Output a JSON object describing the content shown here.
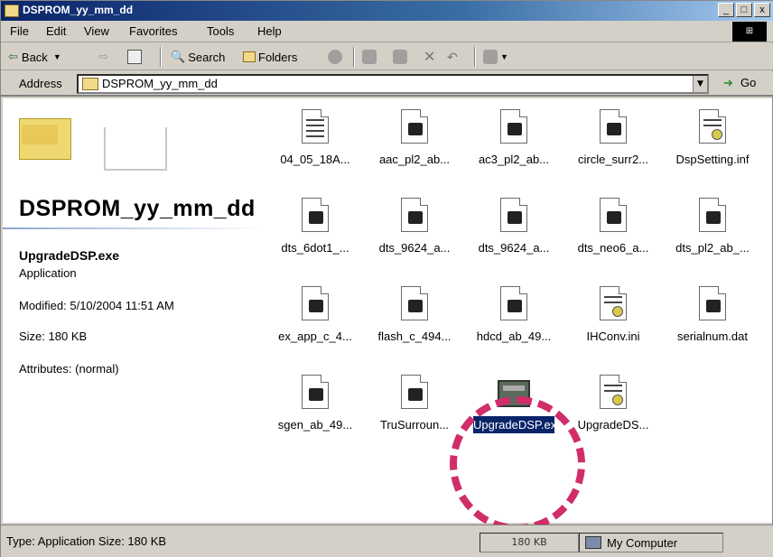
{
  "window": {
    "title": "DSPROM_yy_mm_dd",
    "buttons": [
      "_",
      "□",
      "x"
    ]
  },
  "menu": [
    "File",
    "Edit",
    "View",
    "Favorites",
    "Tools",
    "Help"
  ],
  "toolbar": {
    "back": "Back",
    "search": "Search",
    "folders": "Folders"
  },
  "address": {
    "label": "Address",
    "value": "DSPROM_yy_mm_dd",
    "go": "Go"
  },
  "left_panel": {
    "heading": "DSPROM_yy_mm_dd",
    "file_name": "UpgradeDSP.exe",
    "file_type": "Application",
    "modified": "Modified: 5/10/2004 11:51 AM",
    "size": "Size: 180 KB",
    "attributes": "Attributes: (normal)"
  },
  "files": [
    {
      "label": "04_05_18A...",
      "icon": "text-document-icon"
    },
    {
      "label": "aac_pl2_ab...",
      "icon": "binary-file-icon"
    },
    {
      "label": "ac3_pl2_ab...",
      "icon": "binary-file-icon"
    },
    {
      "label": "circle_surr2...",
      "icon": "binary-file-icon"
    },
    {
      "label": "DspSetting.inf",
      "icon": "settings-file-icon"
    },
    {
      "label": "dts_6dot1_...",
      "icon": "binary-file-icon"
    },
    {
      "label": "dts_9624_a...",
      "icon": "binary-file-icon"
    },
    {
      "label": "dts_9624_a...",
      "icon": "binary-file-icon"
    },
    {
      "label": "dts_neo6_a...",
      "icon": "binary-file-icon"
    },
    {
      "label": "dts_pl2_ab_...",
      "icon": "binary-file-icon"
    },
    {
      "label": "ex_app_c_4...",
      "icon": "binary-file-icon"
    },
    {
      "label": "flash_c_494...",
      "icon": "binary-file-icon"
    },
    {
      "label": "hdcd_ab_49...",
      "icon": "binary-file-icon"
    },
    {
      "label": "IHConv.ini",
      "icon": "settings-file-icon"
    },
    {
      "label": "serialnum.dat",
      "icon": "binary-file-icon"
    },
    {
      "label": "sgen_ab_49...",
      "icon": "binary-file-icon"
    },
    {
      "label": "TruSurroun...",
      "icon": "binary-file-icon"
    },
    {
      "label": "UpgradeDSP.exe",
      "icon": "application-icon",
      "selected": true
    },
    {
      "label": "UpgradeDS...",
      "icon": "settings-file-icon"
    }
  ],
  "status": {
    "text": "Type: Application Size: 180 KB",
    "size": "180 KB",
    "zone": "My Computer"
  },
  "colors": {
    "highlight": "#d12d6a",
    "selection": "#0a246a",
    "title_gradient_start": "#0a246a"
  }
}
